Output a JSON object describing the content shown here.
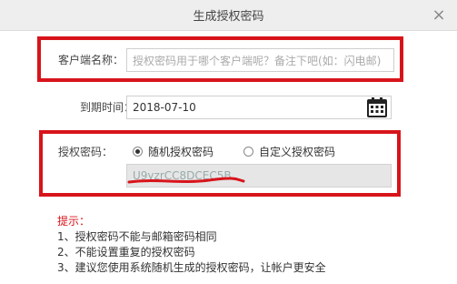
{
  "dialog": {
    "title": "生成授权密码"
  },
  "client_name": {
    "label": "客户端名称：",
    "placeholder": "授权密码用于哪个客户端呢？备注下吧(如：闪电邮)"
  },
  "expiry": {
    "label": "到期时间：",
    "value": "2018-07-10"
  },
  "auth_password": {
    "label": "授权密码：",
    "options": [
      {
        "label": "随机授权密码",
        "checked": true
      },
      {
        "label": "自定义授权密码",
        "checked": false
      }
    ],
    "value": "U9yzrCC8DCEC5B"
  },
  "tips": {
    "title": "提示：",
    "items": [
      "1、授权密码不能与邮箱密码相同",
      "2、不能设置重复的授权密码",
      "3、建议您使用系统随机生成的授权密码，让帐户更安全"
    ]
  },
  "colors": {
    "highlight": "#d8141b",
    "tip_title": "#d8141b"
  }
}
